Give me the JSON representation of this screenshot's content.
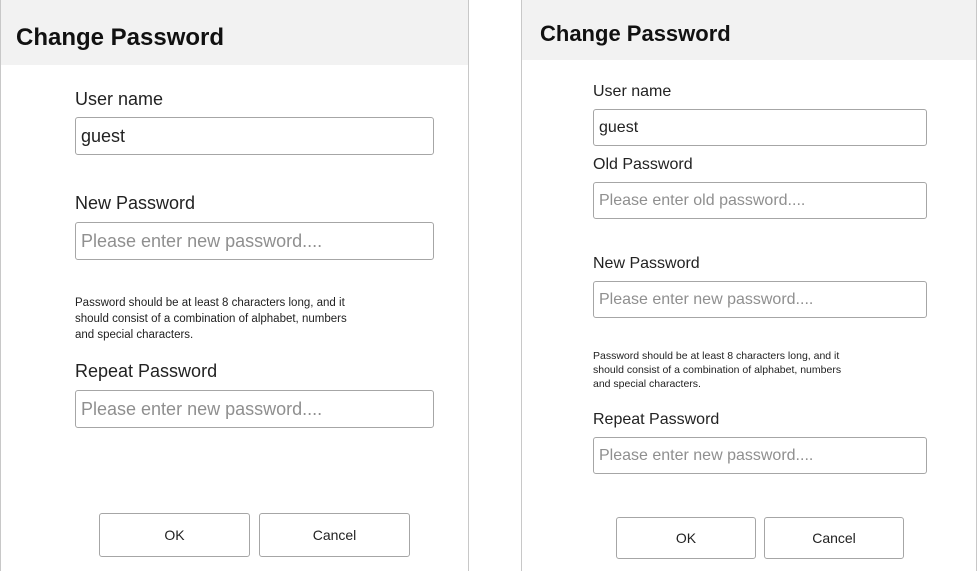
{
  "dialog_left": {
    "title": "Change Password",
    "username_label": "User name",
    "username_value": "guest",
    "new_password_label": "New Password",
    "new_password_placeholder": "Please enter new password....",
    "hint_lines": [
      "Password should be at least 8 characters long, and it",
      "should consist of a combination of alphabet, numbers",
      "and special characters."
    ],
    "repeat_password_label": "Repeat Password",
    "repeat_password_placeholder": "Please enter new password....",
    "ok_label": "OK",
    "cancel_label": "Cancel"
  },
  "dialog_right": {
    "title": "Change Password",
    "username_label": "User name",
    "username_value": "guest",
    "old_password_label": "Old Password",
    "old_password_placeholder": "Please enter old password....",
    "new_password_label": "New Password",
    "new_password_placeholder": "Please enter new password....",
    "hint_lines": [
      "Password should be at least 8 characters long, and it",
      "should consist of a combination of alphabet, numbers",
      "and special characters."
    ],
    "repeat_password_label": "Repeat Password",
    "repeat_password_placeholder": "Please enter new password....",
    "ok_label": "OK",
    "cancel_label": "Cancel"
  }
}
